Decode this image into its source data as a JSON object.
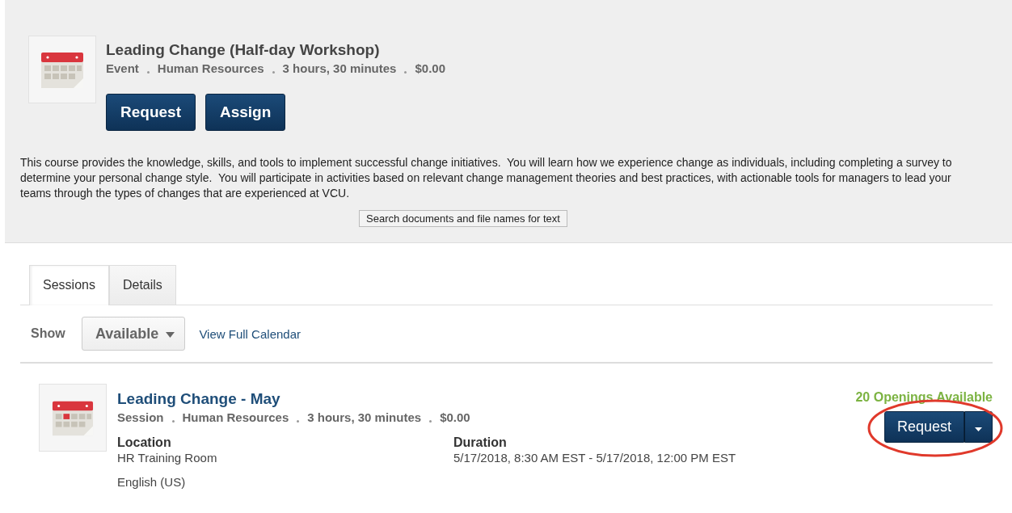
{
  "course": {
    "title": "Leading Change (Half-day Workshop)",
    "meta": [
      "Event",
      "Human Resources",
      "3 hours, 30 minutes",
      "$0.00"
    ],
    "buttons": [
      "Request",
      "Assign"
    ],
    "description": "This course provides the knowledge, skills, and tools to implement successful change initiatives.  You will learn how we experience change as individuals, including completing a survey to determine your personal change style.  You will participate in activities based on relevant change management theories and best practices, with actionable tools for managers to lead your teams through the types of changes that are experienced at VCU."
  },
  "tooltip": "Search documents and file names for text",
  "tabs": [
    {
      "label": "Sessions",
      "selected": true
    },
    {
      "label": "Details",
      "selected": false
    }
  ],
  "filter": {
    "label": "Show",
    "value": "Available",
    "link": "View Full Calendar"
  },
  "sessions": [
    {
      "title": "Leading Change - May",
      "meta": [
        "Session",
        "Human Resources",
        "3 hours, 30 minutes",
        "$0.00"
      ],
      "location_label": "Location",
      "location": "HR Training Room",
      "language": "English (US)",
      "duration_label": "Duration",
      "duration": "5/17/2018, 8:30 AM EST - 5/17/2018, 12:00 PM EST",
      "openings": "20 Openings Available",
      "button": "Request",
      "highlighted": true
    }
  ]
}
